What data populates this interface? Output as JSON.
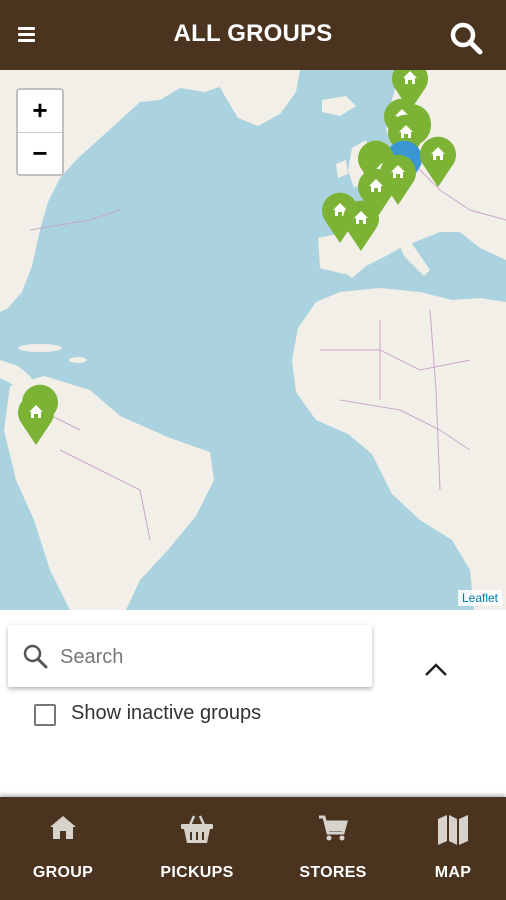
{
  "header": {
    "title": "ALL GROUPS",
    "menu_icon": "menu-icon",
    "search_icon": "search-icon"
  },
  "map": {
    "attribution": "Leaflet",
    "zoom_in_label": "+",
    "zoom_out_label": "−",
    "marker_color": "#7cb335",
    "selected_marker_color": "#3b97d3"
  },
  "search": {
    "placeholder": "Search",
    "value": ""
  },
  "filter": {
    "show_inactive_label": "Show inactive groups",
    "checked": false
  },
  "bottom_nav": {
    "items": [
      {
        "label": "GROUP",
        "icon": "home-icon"
      },
      {
        "label": "PICKUPS",
        "icon": "basket-icon"
      },
      {
        "label": "STORES",
        "icon": "cart-icon"
      },
      {
        "label": "MAP",
        "icon": "map-icon"
      }
    ]
  },
  "colors": {
    "brand": "#4a3420",
    "ocean": "#aad3df",
    "land": "#f2efe9"
  }
}
